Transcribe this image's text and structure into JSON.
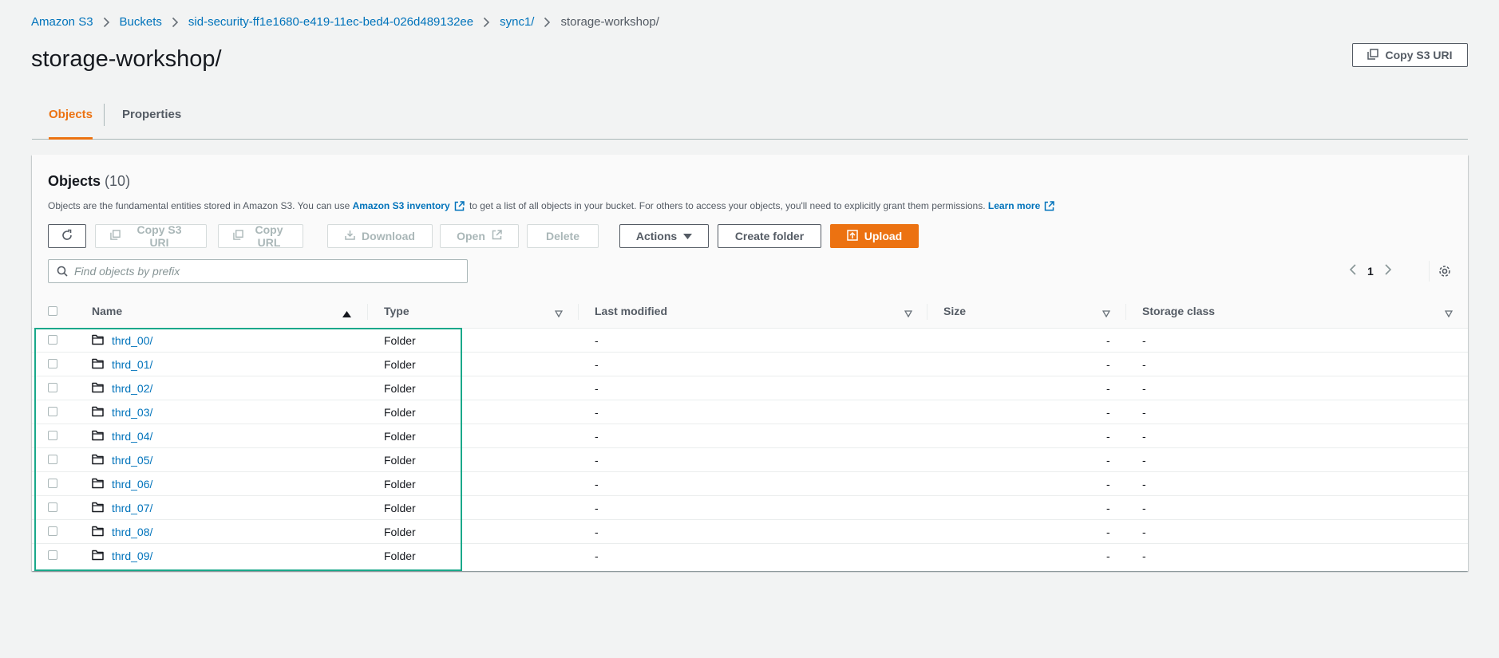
{
  "breadcrumb": {
    "items": [
      "Amazon S3",
      "Buckets",
      "sid-security-ff1e1680-e419-11ec-bed4-026d489132ee",
      "sync1/"
    ],
    "current": "storage-workshop/"
  },
  "page": {
    "title": "storage-workshop/",
    "copy_uri_label": "Copy S3 URI"
  },
  "tabs": [
    {
      "label": "Objects",
      "active": true
    },
    {
      "label": "Properties",
      "active": false
    }
  ],
  "objects_panel": {
    "title": "Objects",
    "count": "(10)",
    "desc_before": "Objects are the fundamental entities stored in Amazon S3. You can use",
    "desc_link": "Amazon S3 inventory",
    "desc_middle": "to get a list of all objects in your bucket. For others to access your objects, you'll need to explicitly grant them permissions.",
    "desc_learn_more": "Learn more"
  },
  "toolbar": {
    "copy_uri": "Copy S3 URI",
    "copy_url": "Copy URL",
    "download": "Download",
    "open": "Open",
    "delete": "Delete",
    "actions": "Actions",
    "create_folder": "Create folder",
    "upload": "Upload"
  },
  "search": {
    "placeholder": "Find objects by prefix",
    "value": ""
  },
  "pagination": {
    "page": "1"
  },
  "table": {
    "columns": [
      "Name",
      "Type",
      "Last modified",
      "Size",
      "Storage class"
    ],
    "rows": [
      {
        "name": "thrd_00/",
        "type": "Folder",
        "last_modified": "-",
        "size": "-",
        "storage_class": "-"
      },
      {
        "name": "thrd_01/",
        "type": "Folder",
        "last_modified": "-",
        "size": "-",
        "storage_class": "-"
      },
      {
        "name": "thrd_02/",
        "type": "Folder",
        "last_modified": "-",
        "size": "-",
        "storage_class": "-"
      },
      {
        "name": "thrd_03/",
        "type": "Folder",
        "last_modified": "-",
        "size": "-",
        "storage_class": "-"
      },
      {
        "name": "thrd_04/",
        "type": "Folder",
        "last_modified": "-",
        "size": "-",
        "storage_class": "-"
      },
      {
        "name": "thrd_05/",
        "type": "Folder",
        "last_modified": "-",
        "size": "-",
        "storage_class": "-"
      },
      {
        "name": "thrd_06/",
        "type": "Folder",
        "last_modified": "-",
        "size": "-",
        "storage_class": "-"
      },
      {
        "name": "thrd_07/",
        "type": "Folder",
        "last_modified": "-",
        "size": "-",
        "storage_class": "-"
      },
      {
        "name": "thrd_08/",
        "type": "Folder",
        "last_modified": "-",
        "size": "-",
        "storage_class": "-"
      },
      {
        "name": "thrd_09/",
        "type": "Folder",
        "last_modified": "-",
        "size": "-",
        "storage_class": "-"
      }
    ]
  },
  "colors": {
    "link": "#0073bb",
    "accent": "#ec7211",
    "highlight": "#1aa88a"
  }
}
